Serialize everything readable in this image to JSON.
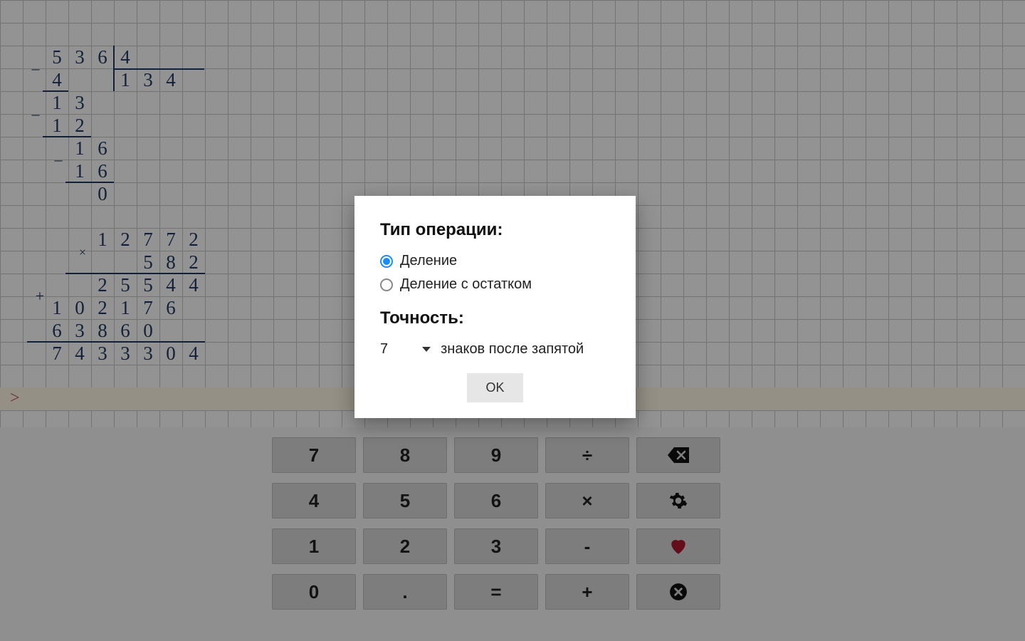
{
  "worksheet": {
    "division": {
      "dividend": [
        "5",
        "3",
        "6",
        "4"
      ],
      "divisor_first": "4",
      "divisor": [
        "1",
        "3",
        "4"
      ],
      "step1_bring": [
        "1",
        "3"
      ],
      "step1_sub": [
        "1",
        "2"
      ],
      "step2_bring": [
        "1",
        "6"
      ],
      "step2_sub": [
        "1",
        "6"
      ],
      "remainder": "0",
      "minus": "–"
    },
    "mult": {
      "a": [
        "1",
        "2",
        "7",
        "7",
        "2"
      ],
      "b": [
        "5",
        "8",
        "2"
      ],
      "times": "×",
      "p1": [
        "2",
        "5",
        "5",
        "4",
        "4"
      ],
      "p2": [
        "1",
        "0",
        "2",
        "1",
        "7",
        "6"
      ],
      "p3": [
        "6",
        "3",
        "8",
        "6",
        "0"
      ],
      "plus": "+",
      "sum": [
        "7",
        "4",
        "3",
        "3",
        "3",
        "0",
        "4"
      ]
    },
    "prompt": ">"
  },
  "keypad": {
    "row1": [
      "7",
      "8",
      "9",
      "÷"
    ],
    "row2": [
      "4",
      "5",
      "6",
      "×"
    ],
    "row3": [
      "1",
      "2",
      "3",
      "-"
    ],
    "row4": [
      "0",
      ".",
      "=",
      "+"
    ]
  },
  "dialog": {
    "title": "Тип операции:",
    "opt1": "Деление",
    "opt2": "Деление с остатком",
    "precision_label": "Точность:",
    "precision_value": "7",
    "precision_suffix": "знаков после запятой",
    "ok": "OK"
  }
}
